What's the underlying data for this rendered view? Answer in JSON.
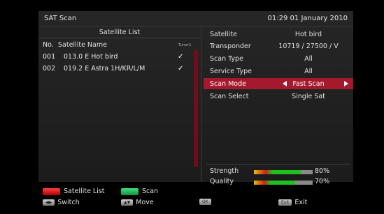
{
  "header": {
    "title": "SAT Scan",
    "datetime": "01:29 01 January 2010"
  },
  "satellite_list": {
    "heading": "Satellite List",
    "col_no": "No.",
    "col_name": "Satellite Name",
    "col_tuner": "Tuner1",
    "rows": [
      {
        "no": "001",
        "name": "013.0 E Hot bird",
        "checked": "✓"
      },
      {
        "no": "002",
        "name": "019.2 E Astra 1H/KR/L/M",
        "checked": "✓"
      }
    ]
  },
  "params": [
    {
      "label": "Satellite",
      "value": "Hot bird"
    },
    {
      "label": "Transponder",
      "value": "10719 / 27500 / V"
    },
    {
      "label": "Scan Type",
      "value": "All"
    },
    {
      "label": "Service Type",
      "value": "All"
    },
    {
      "label": "Scan Mode",
      "value": "Fast Scan"
    },
    {
      "label": "Scan Select",
      "value": "Single Sat"
    }
  ],
  "signal": {
    "strength_label": "Strength",
    "strength_pct": "80%",
    "strength_value": 0.8,
    "quality_label": "Quality",
    "quality_pct": "70%",
    "quality_value": 0.7
  },
  "footer": {
    "red_label": "Satellite List",
    "green_label": "Scan",
    "lr_key": "◀▶",
    "lr_label": "Switch",
    "ud_key": "▲▼",
    "ud_label": "Move",
    "ok_key": "OK",
    "exit_key": "Exit",
    "exit_label": "Exit"
  },
  "colors": {
    "highlight": "#a5192d",
    "scrollbar": "#6e0e1c"
  }
}
